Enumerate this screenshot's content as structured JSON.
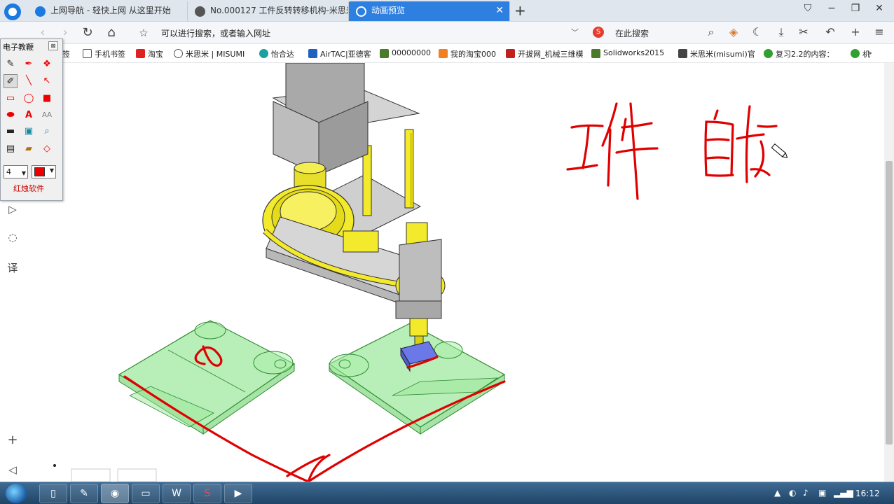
{
  "browser": {
    "tabs": [
      {
        "label": "上网导航 - 轻快上网 从这里开始",
        "favicon_color": "#1a7ae0",
        "active": false
      },
      {
        "label": "No.000127 工件反转转移机构-米思米",
        "favicon_color": "#444444",
        "active": false
      },
      {
        "label": "动画预览",
        "favicon_color": "#ffffff",
        "active": true
      }
    ],
    "new_tab": "+",
    "window_buttons": {
      "pin": "⛉",
      "minimize": "−",
      "restore": "❐",
      "close": "✕"
    }
  },
  "addressbar": {
    "back": "‹",
    "forward": "›",
    "refresh": "↻",
    "home": "⌂",
    "star": "☆",
    "url": "可以进行搜索，或者输入网址",
    "search_engine_icon": "S",
    "search_placeholder": "在此搜索",
    "tools": [
      "gamepad-icon",
      "moon-icon",
      "download-icon",
      "scissors-icon",
      "undo-icon",
      "plus-icon",
      "menu-icon"
    ]
  },
  "bookmarks": [
    {
      "label": "签",
      "color": "#888888"
    },
    {
      "label": "手机书签",
      "color": "#555555"
    },
    {
      "label": "淘宝",
      "color": "#e02020"
    },
    {
      "label": "米思米 | MISUMI",
      "color": "#555555"
    },
    {
      "label": "怡合达",
      "color": "#1aa0a0"
    },
    {
      "label": "AirTAC|亚德客",
      "color": "#2060c0"
    },
    {
      "label": "00000000",
      "color": "#4a7a2a"
    },
    {
      "label": "我的淘宝000",
      "color": "#f08020"
    },
    {
      "label": "开拔网_机械三维模",
      "color": "#c02020"
    },
    {
      "label": "Solidworks2015",
      "color": "#4a7a2a"
    },
    {
      "label": "米思米(misumi)官",
      "color": "#444444"
    },
    {
      "label": "复习2.2的内容：",
      "color": "#30a030"
    },
    {
      "label": "机",
      "color": "#30a030"
    }
  ],
  "bookmarks_more": "»",
  "palette": {
    "title": "电子教鞭",
    "close": "⊠",
    "pen_size": "4",
    "color": "#e00000",
    "brand": "红烛软件",
    "tools": [
      "eraser-icon",
      "pen-icon",
      "brush-icon",
      "pencil-icon",
      "line-icon",
      "arrow-icon",
      "rect-icon",
      "ellipse-icon",
      "filled-rect-icon",
      "filled-ellipse-icon",
      "text-icon",
      "font-size-icon",
      "black-rect-icon",
      "screen-icon",
      "zoom-icon",
      "save-icon",
      "open-icon",
      "clear-icon"
    ]
  },
  "sidebar": {
    "icons": [
      "video-icon",
      "comment-icon",
      "translate-icon",
      "add-icon",
      "collapse-icon"
    ]
  },
  "annotation": {
    "handwriting": "工件 自转",
    "ink_color": "#e00000"
  },
  "taskbar": {
    "apps": [
      "file-icon",
      "sketch-icon",
      "browser-icon",
      "folder-icon",
      "doc-icon",
      "solidworks-icon",
      "player-icon"
    ],
    "clock": "16:12"
  }
}
